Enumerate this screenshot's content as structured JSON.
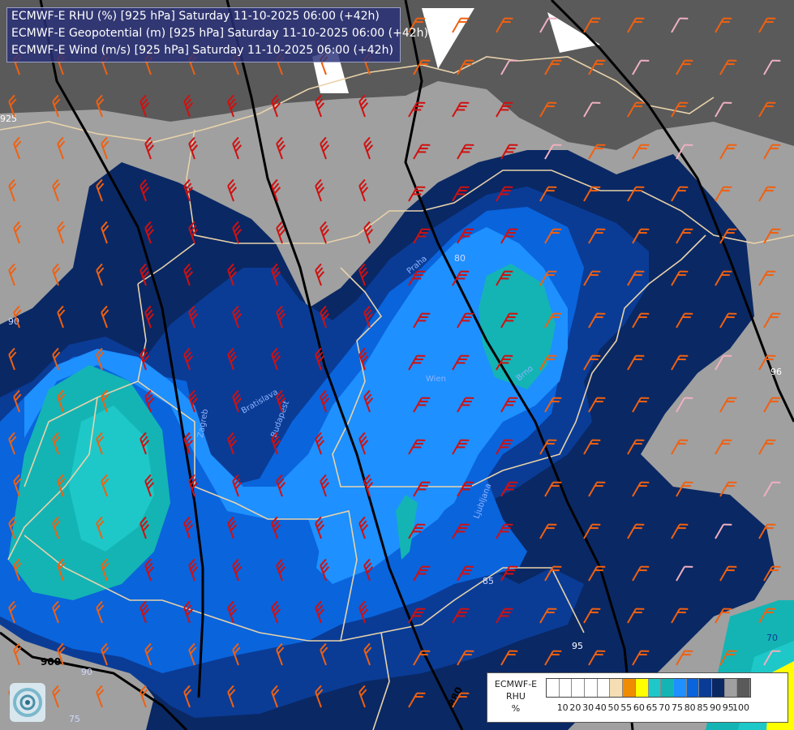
{
  "title_lines": [
    "ECMWF-E RHU (%) [925 hPa] Saturday 11-10-2025 06:00 (+42h)",
    "ECMWF-E Geopotential (m) [925 hPa] Saturday 11-10-2025 06:00 (+42h)",
    "ECMWF-E Wind (m/s) [925 hPa] Saturday 11-10-2025 06:00 (+42h)"
  ],
  "legend": {
    "label_lines": [
      "ECMWF-E",
      "RHU",
      "%"
    ],
    "ticks": [
      "10",
      "20",
      "30",
      "40",
      "50",
      "55",
      "60",
      "65",
      "70",
      "75",
      "80",
      "85",
      "90",
      "95",
      "100"
    ],
    "colors": [
      "#ffffff",
      "#ffffff",
      "#ffffff",
      "#ffffff",
      "#ffffff",
      "#f5deb3",
      "#f08c00",
      "#ffff00",
      "#1ec8c8",
      "#14b4b4",
      "#1e90ff",
      "#0a64dc",
      "#0a3c96",
      "#0a2864",
      "#a0a0a0",
      "#5a5a5a"
    ]
  },
  "geopotential_labels": [
    "925",
    "900",
    "880"
  ],
  "rhu_contour_labels": [
    "80",
    "90",
    "75",
    "96",
    "95",
    "85",
    "70",
    "90"
  ],
  "place_labels": [
    "Praha",
    "Brno",
    "Wien",
    "Bratislava",
    "Budapest",
    "Zagreb",
    "Ljubljana"
  ],
  "colors": {
    "rhu_95_100": "#5a5a5a",
    "rhu_90_95": "#a0a0a0",
    "rhu_85_90": "#0a2864",
    "rhu_80_85": "#0a3c96",
    "rhu_75_80": "#0a64dc",
    "rhu_70_75": "#1e90ff",
    "rhu_65_70": "#14b4b4",
    "rhu_60_65": "#1ec8c8",
    "border_color": "#e8d2aa",
    "geopotential_line": "#000000",
    "barb_strong": "#d01010",
    "barb_medium": "#f06010",
    "barb_light": "#f0b0c0"
  }
}
